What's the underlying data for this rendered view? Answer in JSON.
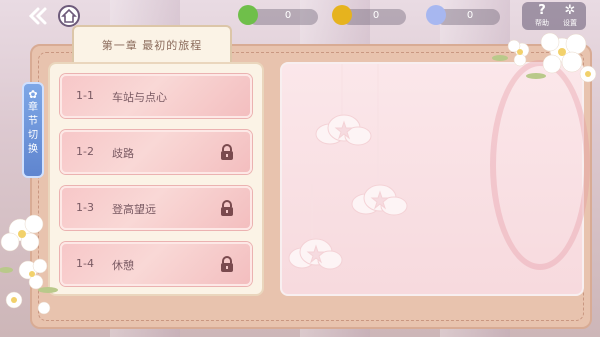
{
  "topbar": {
    "resources": [
      {
        "icon": "clover-icon",
        "value": "0",
        "color": "#6fbf4a"
      },
      {
        "icon": "coin-icon",
        "value": "0",
        "color": "#e6b31e"
      },
      {
        "icon": "gem-icon",
        "value": "0",
        "color": "#a7b7f0"
      }
    ],
    "help_label": "帮助",
    "settings_label": "设置"
  },
  "chapter": {
    "title": "第一章   最初的旅程",
    "switch_label": [
      "章",
      "节",
      "切",
      "换"
    ]
  },
  "levels": [
    {
      "num": "1-1",
      "name": "车站与点心",
      "locked": false
    },
    {
      "num": "1-2",
      "name": "歧路",
      "locked": true
    },
    {
      "num": "1-3",
      "name": "登高望远",
      "locked": true
    },
    {
      "num": "1-4",
      "name": "休憩",
      "locked": true
    }
  ]
}
